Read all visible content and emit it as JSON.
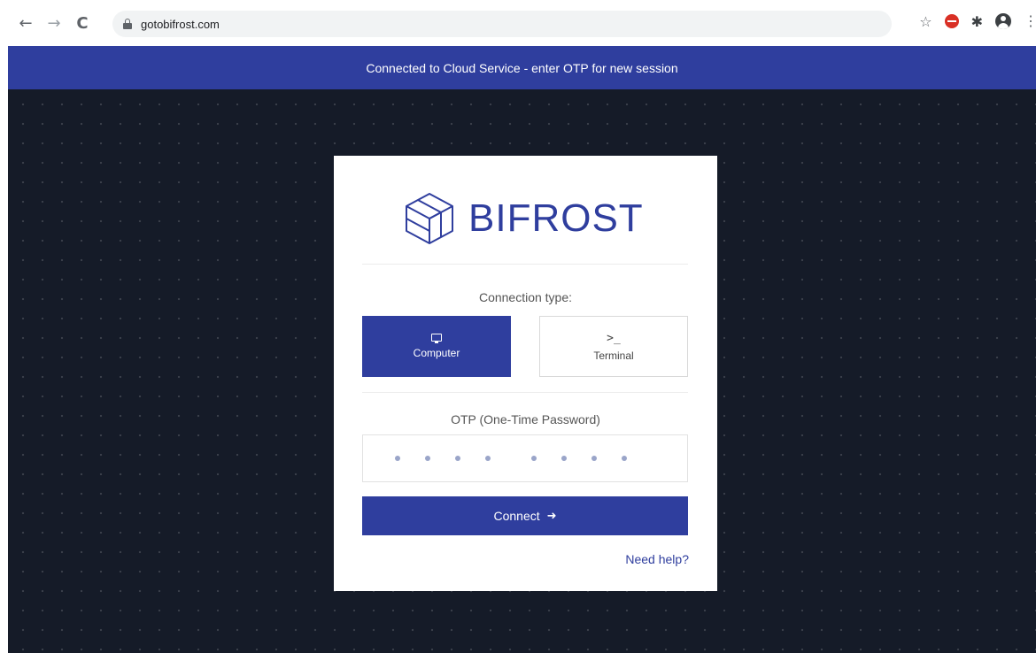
{
  "browser": {
    "url": "gotobifrost.com",
    "back_icon": "←",
    "forward_icon": "→",
    "reload_icon": "C",
    "star_icon": "☆",
    "menu_icon": "⋮"
  },
  "banner": {
    "text": "Connected to Cloud Service - enter OTP for new session"
  },
  "login": {
    "brand": "BIFROST",
    "connection_type_label": "Connection type:",
    "options": [
      {
        "label": "Computer",
        "selected": true
      },
      {
        "label": "Terminal",
        "selected": false
      }
    ],
    "terminal_glyph": ">_",
    "otp_label": "OTP (One-Time Password)",
    "connect_label": "Connect",
    "connect_arrow": "➜",
    "help_link": "Need help?"
  },
  "colors": {
    "brand": "#2f3e9e",
    "background": "#151b28"
  }
}
